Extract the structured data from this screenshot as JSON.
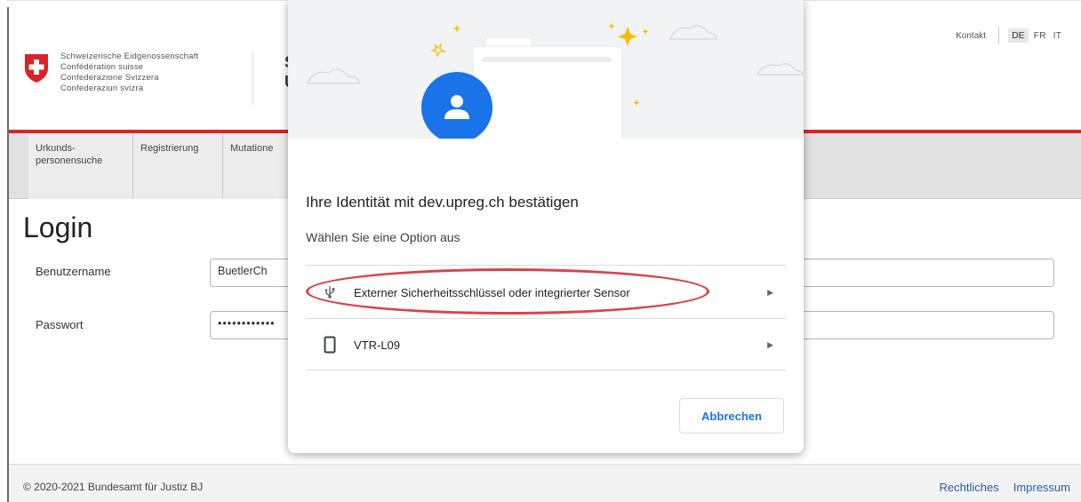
{
  "header": {
    "coat_of_arms": [
      "Schweizerische Eidgenossenschaft",
      "Confédération suisse",
      "Confederazione Svizzera",
      "Confederaziun svizra"
    ],
    "title_fragment_1": "S",
    "title_fragment_2": "U",
    "contact_label": "Kontakt",
    "languages": [
      "DE",
      "FR",
      "IT"
    ],
    "active_language": "DE"
  },
  "nav": {
    "items": [
      {
        "label_line1": "Urkunds-",
        "label_line2": "personensuche"
      },
      {
        "label_line1": "Registrierung",
        "label_line2": ""
      },
      {
        "label_line1": "Mutatione",
        "label_line2": ""
      }
    ]
  },
  "login": {
    "title": "Login",
    "username_label": "Benutzername",
    "username_value": "BuetlerCh",
    "password_label": "Passwort",
    "password_value": "••••••••••••"
  },
  "footer": {
    "copyright": "© 2020-2021 Bundesamt für Justiz BJ",
    "links": [
      "Rechtliches",
      "Impressum"
    ]
  },
  "dialog": {
    "title": "Ihre Identität mit dev.upreg.ch bestätigen",
    "subtitle": "Wählen Sie eine Option aus",
    "options": [
      {
        "label": "Externer Sicherheitsschlüssel oder integrierter Sensor",
        "icon": "usb-icon"
      },
      {
        "label": "VTR-L09",
        "icon": "phone-icon"
      }
    ],
    "cancel_label": "Abbrechen"
  },
  "colors": {
    "swiss_red": "#d8232a",
    "highlight_red": "#d9434b",
    "link_blue": "#1f5f9e",
    "google_blue": "#1a73e8",
    "avatar_blue": "#1a73e8"
  }
}
